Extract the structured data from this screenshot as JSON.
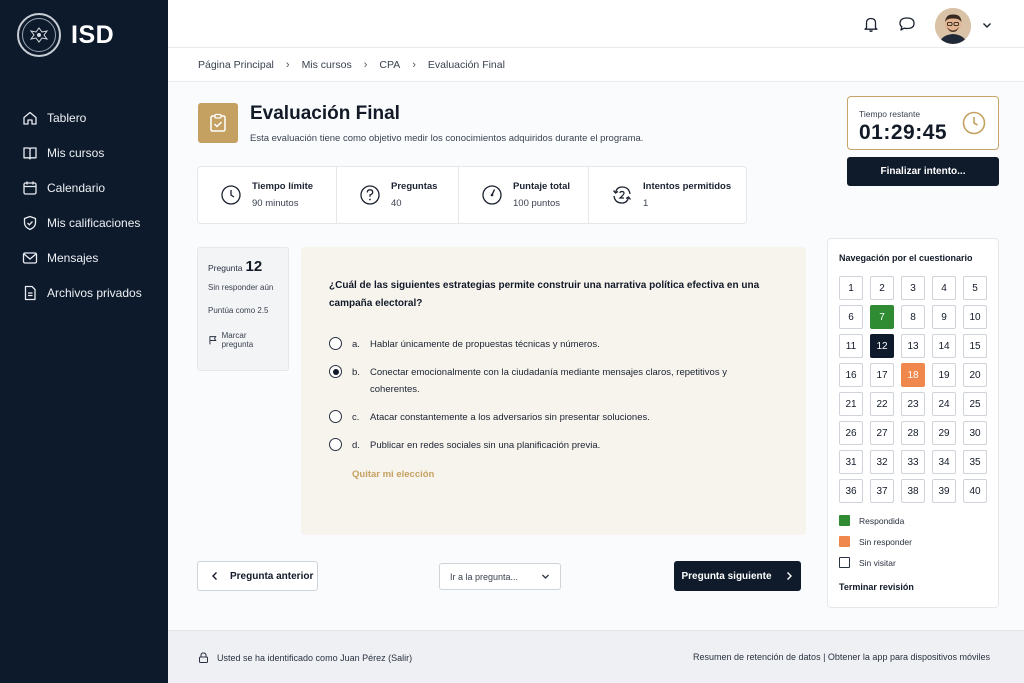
{
  "brand": {
    "name": "ISD",
    "seal_text": "ISD"
  },
  "sidebar": {
    "items": [
      {
        "label": "Tablero",
        "icon": "home-icon"
      },
      {
        "label": "Mis cursos",
        "icon": "book-icon"
      },
      {
        "label": "Calendario",
        "icon": "calendar-icon"
      },
      {
        "label": "Mis calificaciones",
        "icon": "badge-icon"
      },
      {
        "label": "Mensajes",
        "icon": "mail-icon"
      },
      {
        "label": "Archivos privados",
        "icon": "file-icon"
      }
    ]
  },
  "topbar": {
    "icons": [
      "bell-icon",
      "chat-icon",
      "avatar",
      "chevron-down-icon"
    ]
  },
  "breadcrumb": [
    "Página Principal",
    "Mis cursos",
    "CPA",
    "Evaluación Final"
  ],
  "header": {
    "title": "Evaluación Final",
    "description": "Esta evaluación tiene como objetivo medir los conocimientos adquiridos durante el programa."
  },
  "stats": [
    {
      "label": "Tiempo límite",
      "value": "90 minutos",
      "icon": "clock-icon"
    },
    {
      "label": "Preguntas",
      "value": "40",
      "icon": "question-icon"
    },
    {
      "label": "Puntaje total",
      "value": "100 puntos",
      "icon": "gauge-icon"
    },
    {
      "label": "Intentos permitidos",
      "value": "1",
      "icon": "retry-icon"
    }
  ],
  "timer": {
    "label": "Tiempo restante",
    "value": "01:29:45"
  },
  "finish_label": "Finalizar intento...",
  "question_info": {
    "label": "Pregunta",
    "number": "12",
    "status": "Sin responder aún",
    "points": "Puntúa como 2.5",
    "flag_label": "Marcar pregunta"
  },
  "question": {
    "text": "¿Cuál de las siguientes estrategias permite construir una narrativa política efectiva en una campaña electoral?",
    "selected": "b",
    "options": [
      {
        "letter": "a.",
        "text": "Hablar únicamente de propuestas técnicas y números."
      },
      {
        "letter": "b.",
        "text": "Conectar emocionalmente con la ciudadanía mediante mensajes claros, repetitivos y coherentes."
      },
      {
        "letter": "c.",
        "text": "Atacar constantemente a los adversarios sin presentar soluciones."
      },
      {
        "letter": "d.",
        "text": "Publicar en redes sociales sin una planificación previa."
      }
    ],
    "clear_label": "Quitar mi elección"
  },
  "nav_buttons": {
    "prev_label": "Pregunta anterior",
    "goto_label": "Ir a la pregunta...",
    "next_label": "Pregunta siguiente"
  },
  "quiz_nav": {
    "title": "Navegación por el cuestionario",
    "total": 40,
    "answered": [
      7
    ],
    "current": 12,
    "unanswered": [
      18
    ],
    "legend": [
      {
        "label": "Respondida",
        "color": "#2f8c33"
      },
      {
        "label": "Sin responder",
        "color": "#f0874d"
      },
      {
        "label": "Sin visitar",
        "color": "#ffffff"
      }
    ],
    "review_label": "Terminar revisión"
  },
  "footer": {
    "identity": "Usted se ha identificado como Juan Pérez (Salir)",
    "links": "Resumen de retención de datos | Obtener la app para dispositivos móviles"
  },
  "colors": {
    "sidebar": "#0d1a2b",
    "accent_gold": "#c5a161",
    "answered": "#2f8c33",
    "unanswered": "#f0874d",
    "primary": "#0f1b2b"
  }
}
